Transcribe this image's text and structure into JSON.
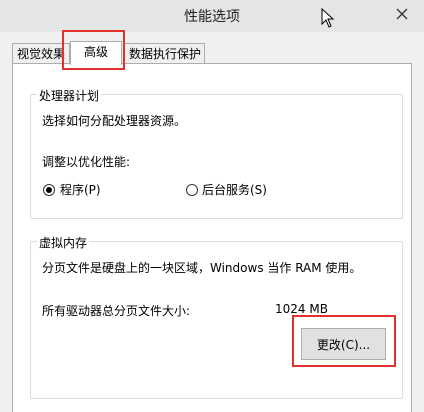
{
  "window": {
    "title": "性能选项"
  },
  "tabs": [
    {
      "label": "视觉效果"
    },
    {
      "label": "高级",
      "active": true
    },
    {
      "label": "数据执行保护"
    }
  ],
  "processor": {
    "group_title": "处理器计划",
    "description": "选择如何分配处理器资源。",
    "adjust_label": "调整以优化性能:",
    "options": [
      {
        "label": "程序(P)",
        "checked": true
      },
      {
        "label": "后台服务(S)",
        "checked": false
      }
    ]
  },
  "virtual_memory": {
    "group_title": "虚拟内存",
    "description": "分页文件是硬盘上的一块区域，Windows 当作 RAM 使用。",
    "total_label": "所有驱动器总分页文件大小:",
    "total_value": "1024 MB",
    "change_button": "更改(C)..."
  },
  "colors": {
    "highlight": "#e0312c",
    "titlebar": "#e5e5e5",
    "dialog_bg": "#f0f0f0"
  },
  "icons": [
    "close-icon",
    "mouse-cursor-icon"
  ]
}
